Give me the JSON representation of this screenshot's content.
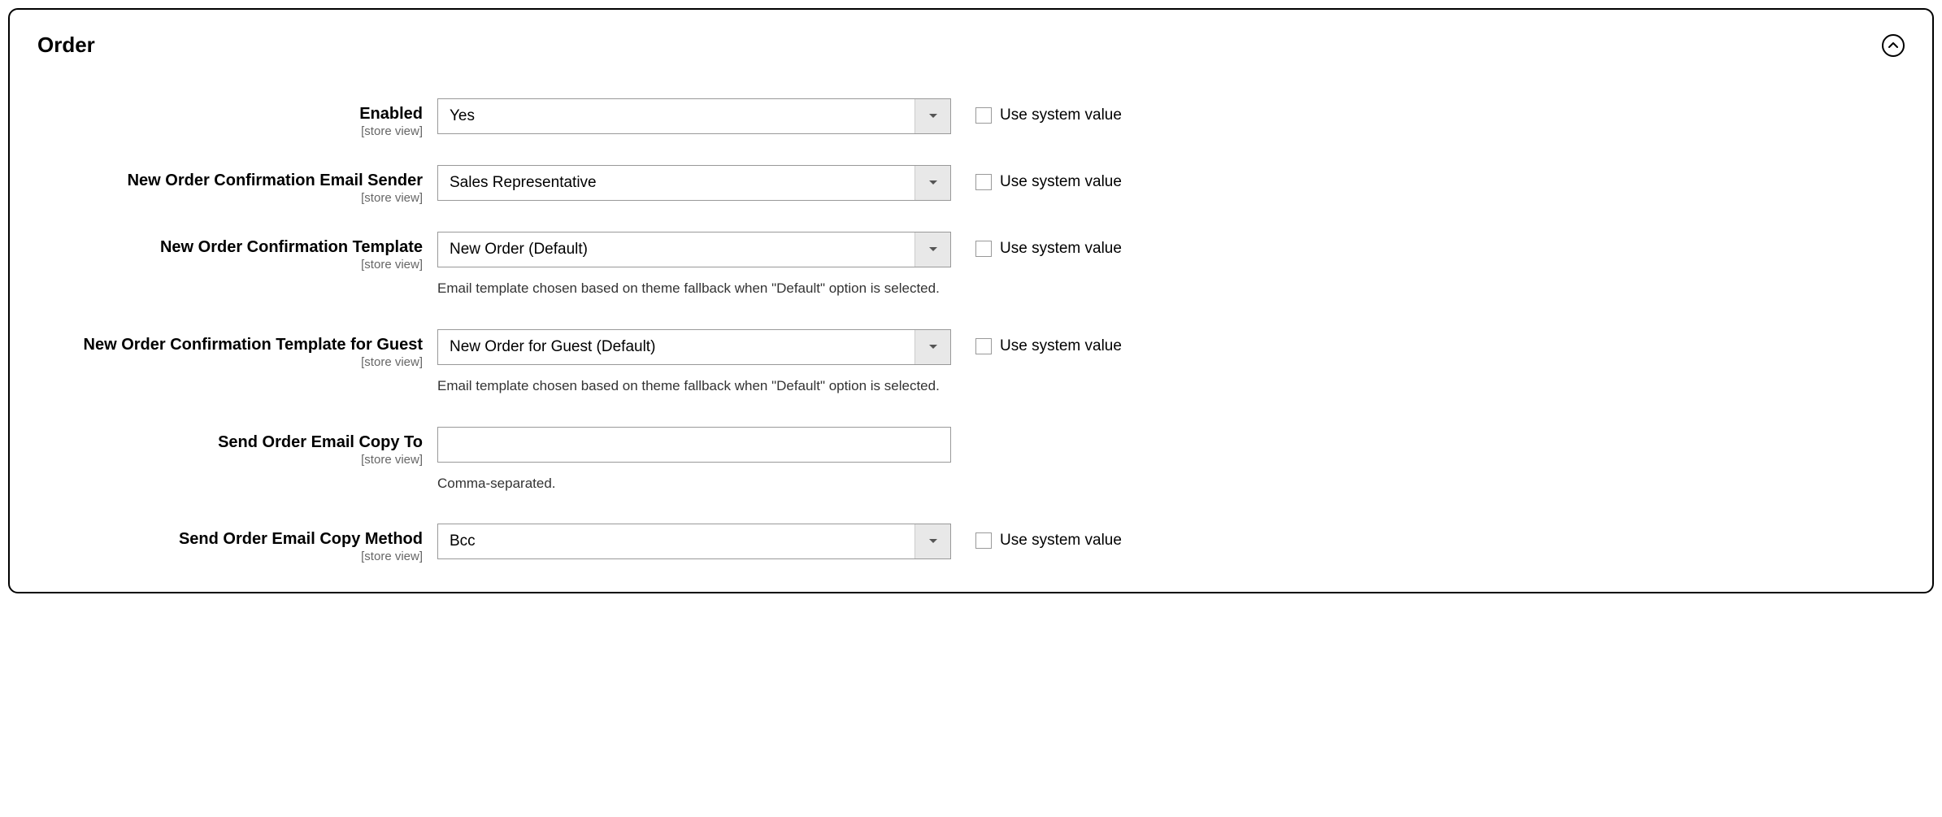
{
  "section": {
    "title": "Order"
  },
  "common": {
    "scope": "[store view]",
    "use_system_value": "Use system value"
  },
  "fields": {
    "enabled": {
      "label": "Enabled",
      "value": "Yes"
    },
    "sender": {
      "label": "New Order Confirmation Email Sender",
      "value": "Sales Representative"
    },
    "template": {
      "label": "New Order Confirmation Template",
      "value": "New Order (Default)",
      "note": "Email template chosen based on theme fallback when \"Default\" option is selected."
    },
    "guest_template": {
      "label": "New Order Confirmation Template for Guest",
      "value": "New Order for Guest (Default)",
      "note": "Email template chosen based on theme fallback when \"Default\" option is selected."
    },
    "copy_to": {
      "label": "Send Order Email Copy To",
      "value": "",
      "note": "Comma-separated."
    },
    "copy_method": {
      "label": "Send Order Email Copy Method",
      "value": "Bcc"
    }
  }
}
